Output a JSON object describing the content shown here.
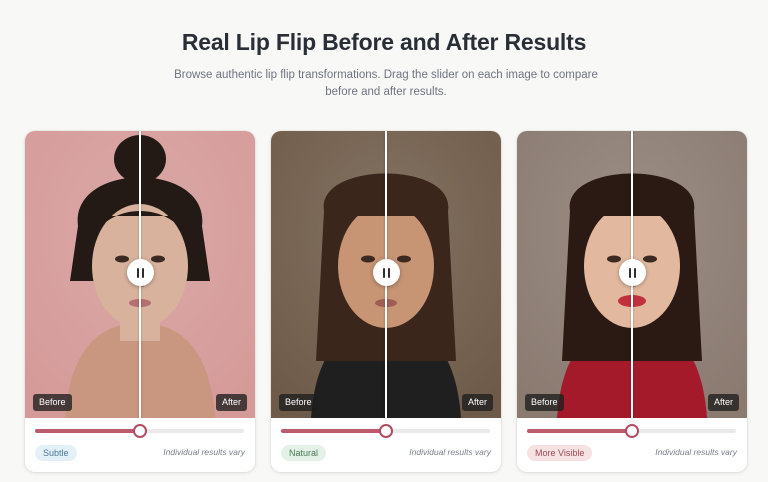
{
  "header": {
    "title": "Real Lip Flip Before and After Results",
    "subtitle": "Browse authentic lip flip transformations. Drag the slider on each image to compare before and after results."
  },
  "cards": [
    {
      "before_label": "Before",
      "after_label": "After",
      "slider_value": 0.5,
      "badge": "Subtle",
      "badge_bg": "#e4f0f8",
      "badge_color": "#4a7896",
      "note": "Individual results vary",
      "background": "#d49a98",
      "hair_color": "#231a15",
      "skin_color": "#d8b29c",
      "clothing_color": "#c9967f",
      "lip_color": "#b36f72"
    },
    {
      "before_label": "Before",
      "after_label": "After",
      "slider_value": 0.5,
      "badge": "Natural",
      "badge_bg": "#e3f1e6",
      "badge_color": "#4a7a56",
      "note": "Individual results vary",
      "background": "#6e5a48",
      "hair_color": "#3a261b",
      "skin_color": "#c79474",
      "clothing_color": "#1f1f1f",
      "lip_color": "#9e5e55"
    },
    {
      "before_label": "Before",
      "after_label": "After",
      "slider_value": 0.5,
      "badge": "More Visible",
      "badge_bg": "#f6e1e3",
      "badge_color": "#9b4b55",
      "note": "Individual results vary",
      "background": "#8a7a70",
      "hair_color": "#2a1a13",
      "skin_color": "#e2b89f",
      "clothing_color": "#a51a2a",
      "lip_color": "#c0303d"
    }
  ]
}
